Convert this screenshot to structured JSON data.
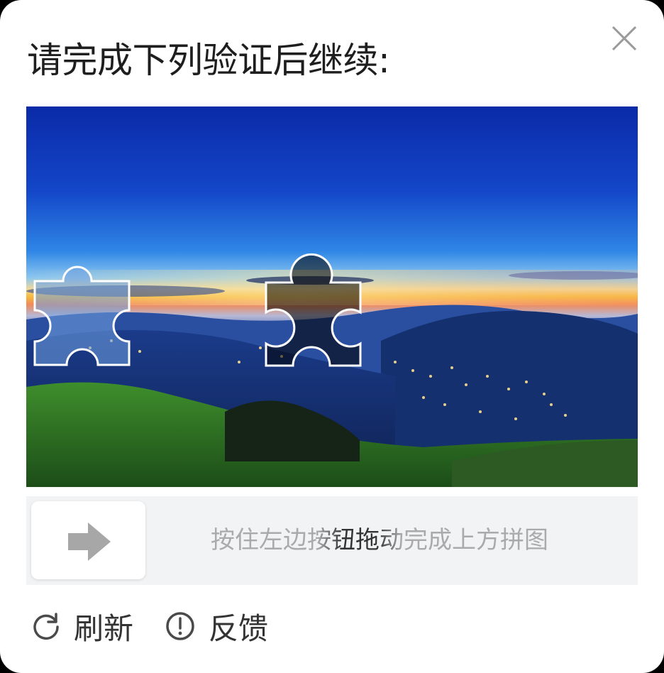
{
  "dialog": {
    "title": "请完成下列验证后继续:",
    "close_icon": "close-icon"
  },
  "puzzle": {
    "scene": "mountain city night skyline at dusk",
    "piece_icon": "puzzle-piece",
    "gap_icon": "puzzle-gap"
  },
  "slider": {
    "handle_icon": "arrow-right-icon",
    "hint": "按住左边按钮拖动完成上方拼图"
  },
  "footer": {
    "refresh": {
      "icon": "refresh-icon",
      "label": "刷新"
    },
    "feedback": {
      "icon": "exclamation-circle-icon",
      "label": "反馈"
    }
  }
}
